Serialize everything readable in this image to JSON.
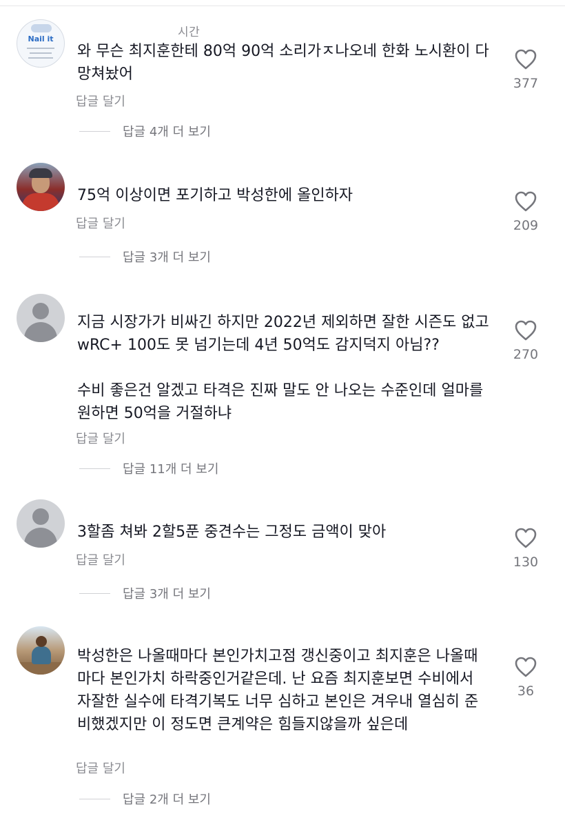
{
  "comments": [
    {
      "username": "시간",
      "text": "와 무슨 최지훈한테 80억 90억 소리가ㅈ나오네 한화 노시환이 다 망쳐놨어",
      "reply_label": "답글 달기",
      "more_replies": "답글 4개 더 보기",
      "likes": "377",
      "avatar_label": "Nail it"
    },
    {
      "username": "",
      "text": "75억 이상이면 포기하고 박성한에 올인하자",
      "reply_label": "답글 달기",
      "more_replies": "답글 3개 더 보기",
      "likes": "209"
    },
    {
      "username": "",
      "text": "지금 시장가가 비싸긴 하지만 2022년 제외하면 잘한 시즌도 없고 wRC+ 100도 못 넘기는데 4년 50억도 감지덕지 아님??",
      "text2": "수비 좋은건 알겠고 타격은 진짜 말도 안 나오는 수준인데 얼마를 원하면 50억을 거절하냐",
      "reply_label": "답글 달기",
      "more_replies": "답글 11개 더 보기",
      "likes": "270"
    },
    {
      "username": "",
      "text": "3할좀 쳐봐 2할5푼 중견수는 그정도 금액이 맞아",
      "reply_label": "답글 달기",
      "more_replies": "답글 3개 더 보기",
      "likes": "130"
    },
    {
      "username": "",
      "text": "박성한은 나올때마다 본인가치고점 갱신중이고 최지훈은 나올때마다 본인가치 하락중인거같은데. 난 요즘 최지훈보면 수비에서 자잘한 실수에 타격기복도 너무 심하고 본인은 겨우내 열심히 준비했겠지만 이 정도면 큰계약은 힘들지않을까 싶은데",
      "reply_label": "답글 달기",
      "more_replies": "답글 2개 더 보기",
      "likes": "36"
    }
  ],
  "icons": {
    "like": "heart-outline-icon",
    "avatar_default": "default-avatar-icon"
  },
  "colors": {
    "text": "#161823",
    "muted": "#8a8b91",
    "icon": "#75767c"
  }
}
